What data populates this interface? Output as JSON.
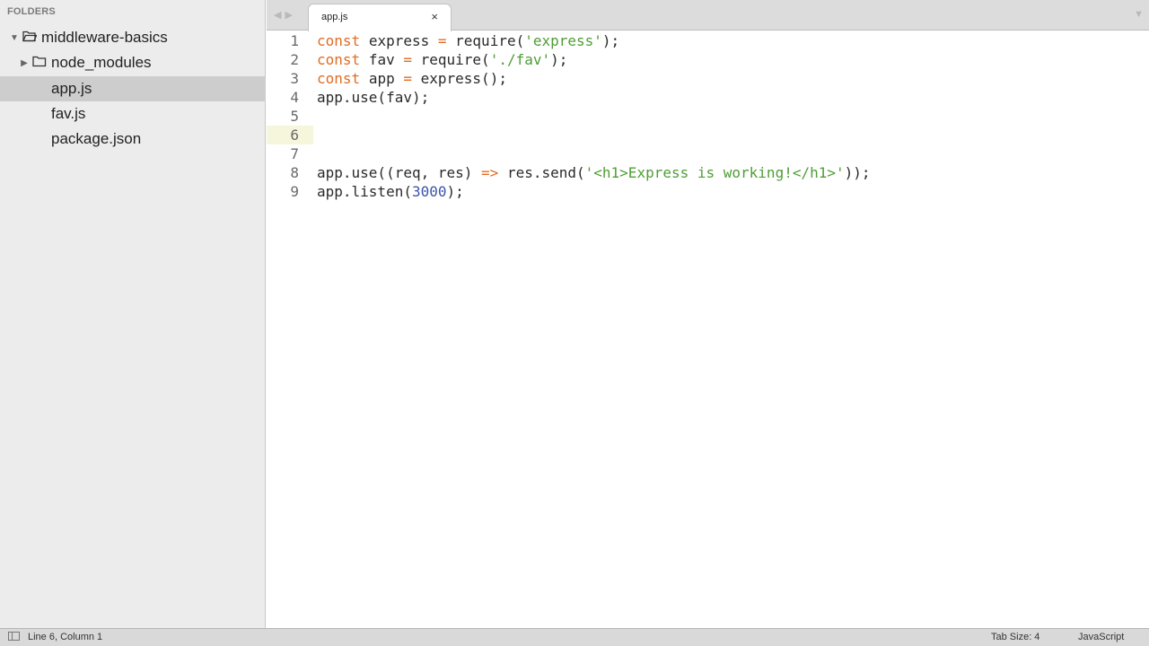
{
  "sidebar": {
    "header": "FOLDERS",
    "tree": [
      {
        "label": "middleware-basics",
        "type": "folder-open",
        "expanded": true,
        "selected": false
      },
      {
        "label": "node_modules",
        "type": "folder",
        "expanded": false,
        "selected": false
      },
      {
        "label": "app.js",
        "type": "file",
        "selected": true
      },
      {
        "label": "fav.js",
        "type": "file",
        "selected": false
      },
      {
        "label": "package.json",
        "type": "file",
        "selected": false
      }
    ]
  },
  "tabs": [
    {
      "label": "app.js",
      "close_glyph": "×",
      "active": true
    }
  ],
  "editor": {
    "current_line": 6,
    "lines": [
      {
        "num": "1",
        "tokens": [
          [
            "kw",
            "const"
          ],
          [
            "",
            "express "
          ],
          [
            "kw",
            "="
          ],
          [
            "",
            "require("
          ],
          [
            "str",
            "'express'"
          ],
          [
            "",
            ");"
          ]
        ]
      },
      {
        "num": "2",
        "tokens": [
          [
            "kw",
            "const"
          ],
          [
            "",
            "fav "
          ],
          [
            "kw",
            "="
          ],
          [
            "",
            "require("
          ],
          [
            "str",
            "'./fav'"
          ],
          [
            "",
            ");"
          ]
        ]
      },
      {
        "num": "3",
        "tokens": [
          [
            "kw",
            "const"
          ],
          [
            "",
            "app "
          ],
          [
            "kw",
            "="
          ],
          [
            "",
            "express();"
          ]
        ]
      },
      {
        "num": "4",
        "tokens": [
          [
            "",
            "app.use(fav);"
          ]
        ]
      },
      {
        "num": "5",
        "tokens": []
      },
      {
        "num": "6",
        "tokens": []
      },
      {
        "num": "7",
        "tokens": []
      },
      {
        "num": "8",
        "tokens": [
          [
            "",
            "app.use((req, res) "
          ],
          [
            "kw",
            "=>"
          ],
          [
            "",
            "res.send("
          ],
          [
            "str",
            "'<h1>Express is working!</h1>'"
          ],
          [
            "",
            "));"
          ]
        ]
      },
      {
        "num": "9",
        "tokens": [
          [
            "",
            "app.listen("
          ],
          [
            "num",
            "3000"
          ],
          [
            "",
            ");"
          ]
        ]
      }
    ]
  },
  "statusbar": {
    "position": "Line 6, Column 1",
    "tab_size": "Tab Size: 4",
    "syntax": "JavaScript"
  },
  "colors": {
    "keyword": "#e06d25",
    "string": "#4f9d35",
    "number": "#3a55a8",
    "current_line_highlight": "#f6f6dd"
  }
}
